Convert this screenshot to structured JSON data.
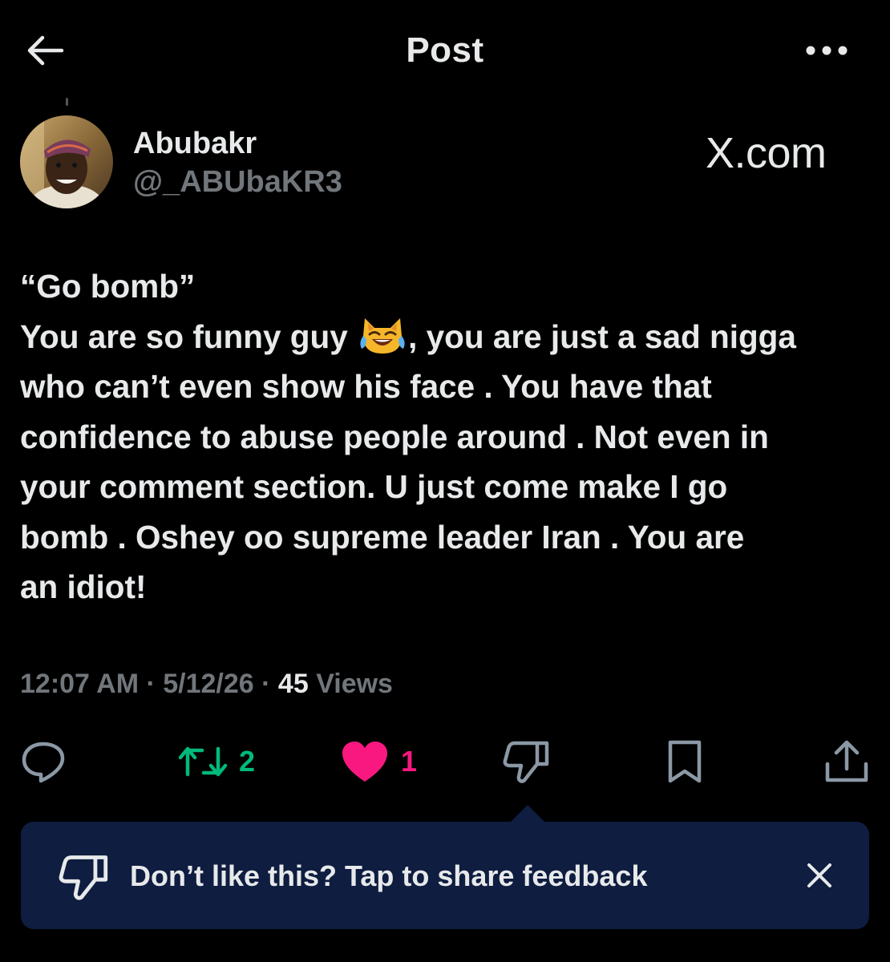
{
  "header": {
    "title": "Post"
  },
  "author": {
    "display_name": "Abubakr",
    "handle": "@_ABUbaKR3"
  },
  "watermark": "X.com",
  "post": {
    "lines": [
      "“Go bomb”",
      "You are so funny guy",
      ", you are just a sad nigga",
      "who can’t even show his face . You have that",
      "confidence to abuse people around . Not even in",
      "your comment section. U just come make I go",
      "bomb . Oshey oo supreme leader Iran . You are",
      "an idiot!"
    ],
    "emoji_name": "face-with-tears-of-joy-cat"
  },
  "meta": {
    "time": "12:07 AM",
    "separator": " · ",
    "date": "5/12/26",
    "views_count": "45",
    "views_label": " Views"
  },
  "actions": {
    "repost_count": "2",
    "like_count": "1"
  },
  "feedback": {
    "text": "Don’t like this? Tap to share feedback"
  },
  "colors": {
    "background": "#000000",
    "text": "#e7e9ea",
    "muted": "#71767b",
    "repost": "#00ba7c",
    "like": "#f91880",
    "feedback_bg": "#0e1d40"
  },
  "icons": [
    "back-arrow-icon",
    "more-icon",
    "reply-icon",
    "repost-icon",
    "like-icon",
    "dislike-icon",
    "bookmark-icon",
    "share-icon",
    "close-icon"
  ]
}
